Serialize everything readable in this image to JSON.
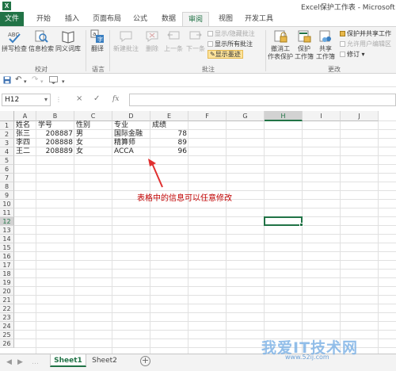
{
  "window": {
    "title": "Excel保护工作表 - Microsoft Ex",
    "app_icon": "X"
  },
  "tabs": [
    {
      "label": "文件"
    },
    {
      "label": "开始"
    },
    {
      "label": "插入"
    },
    {
      "label": "页面布局"
    },
    {
      "label": "公式"
    },
    {
      "label": "数据"
    },
    {
      "label": "审阅"
    },
    {
      "label": "视图"
    },
    {
      "label": "开发工具"
    }
  ],
  "ribbon": {
    "proofing": {
      "spelling": "拼写检查",
      "research": "信息检索",
      "thesaurus": "同义词库",
      "group": "校对"
    },
    "language": {
      "translate": "翻译",
      "group": "语言"
    },
    "comments": {
      "new": "新建批注",
      "delete": "删除",
      "prev": "上一条",
      "next": "下一条",
      "show_hide": "显示/隐藏批注",
      "show_all": "显示所有批注",
      "show_ink": "显示墨迹",
      "group": "批注"
    },
    "changes": {
      "unprotect_sheet": [
        "撤消工",
        "作表保护"
      ],
      "protect_workbook": [
        "保护",
        "工作簿"
      ],
      "share_workbook": [
        "共享",
        "工作簿"
      ],
      "protect_share": "保护并共享工作",
      "allow_edit": "允许用户编辑区",
      "track": "修订",
      "group": "更改"
    }
  },
  "qat": {
    "save_icon": "save-icon",
    "undo_icon": "undo-icon",
    "redo_icon": "redo-icon"
  },
  "formula_bar": {
    "name_box": "H12",
    "cancel": "×",
    "enter": "✓",
    "fx": "fx",
    "value": ""
  },
  "sheet": {
    "columns": [
      "A",
      "B",
      "C",
      "D",
      "E",
      "F",
      "G",
      "H",
      "I",
      "J"
    ],
    "selected_column": "H",
    "selected_row": "12",
    "rows": [
      "1",
      "2",
      "3",
      "4",
      "5",
      "6",
      "7",
      "8",
      "9",
      "10",
      "11",
      "12",
      "13",
      "14",
      "15",
      "16",
      "17",
      "18",
      "19",
      "20",
      "21",
      "22",
      "23",
      "24",
      "25",
      "26"
    ],
    "header": [
      "姓名",
      "学号",
      "性别",
      "专业",
      "成绩"
    ],
    "data": [
      [
        "张三",
        "208887",
        "男",
        "国际金融",
        "78"
      ],
      [
        "李四",
        "208888",
        "女",
        "精算师",
        "89"
      ],
      [
        "王二",
        "208889",
        "女",
        "ACCA",
        "96"
      ]
    ]
  },
  "annotation": "表格中的信息可以任意修改",
  "annotation_color": "#c00000",
  "sheet_tabs": [
    {
      "label": "Sheet1",
      "active": true
    },
    {
      "label": "Sheet2",
      "active": false
    }
  ],
  "add_sheet": "+",
  "watermark": {
    "text": "我爱IT技术网",
    "url": "www.52ij.com"
  },
  "colors": {
    "accent": "#217346",
    "ribbon_bg": "#f3f3f3"
  }
}
